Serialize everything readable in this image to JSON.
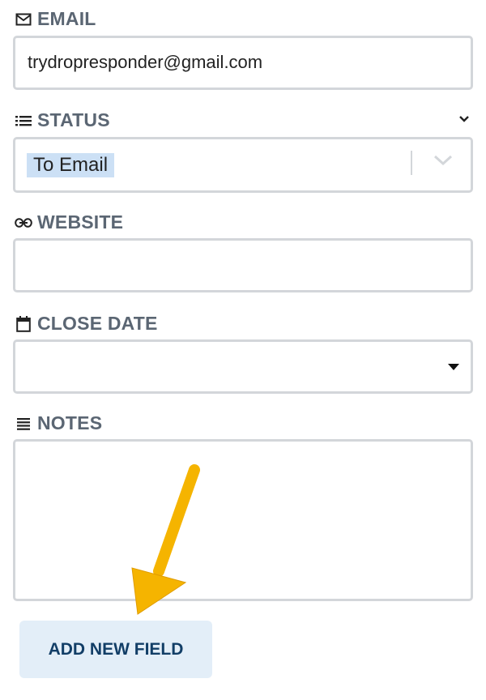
{
  "fields": {
    "email": {
      "label": "EMAIL",
      "icon": "envelope-icon",
      "value": "trydropresponder@gmail.com"
    },
    "status": {
      "label": "STATUS",
      "icon": "list-icon",
      "value": "To Email"
    },
    "website": {
      "label": "WEBSITE",
      "icon": "link-icon",
      "value": ""
    },
    "close_date": {
      "label": "CLOSE DATE",
      "icon": "calendar-icon",
      "value": ""
    },
    "notes": {
      "label": "NOTES",
      "icon": "notes-icon",
      "value": ""
    }
  },
  "add_field_button": {
    "label": "ADD NEW FIELD"
  },
  "colors": {
    "label": "#5b6673",
    "border": "#d3d6da",
    "chip": "#cce0f5",
    "button_bg": "#e3eef8",
    "button_text": "#123e67",
    "arrow": "#f5b400"
  }
}
